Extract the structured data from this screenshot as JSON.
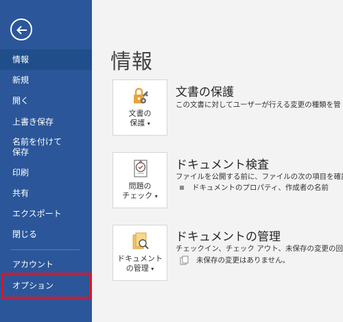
{
  "sidebar": {
    "back_label": "戻る",
    "items": [
      {
        "label": "情報",
        "active": true
      },
      {
        "label": "新規"
      },
      {
        "label": "開く"
      },
      {
        "label": "上書き保存"
      },
      {
        "label": "名前を付けて\n保存"
      },
      {
        "label": "印刷"
      },
      {
        "label": "共有"
      },
      {
        "label": "エクスポート"
      },
      {
        "label": "閉じる"
      },
      {
        "label": "アカウント"
      },
      {
        "label": "オプション",
        "highlighted": true
      }
    ]
  },
  "main": {
    "title": "情報",
    "sections": [
      {
        "tile_line1": "文書の",
        "tile_line2": "保護",
        "title": "文書の保護",
        "description": "この文書に対してユーザーが行える変更の種類を管"
      },
      {
        "tile_line1": "問題の",
        "tile_line2": "チェック",
        "title": "ドキュメント検査",
        "description": "ファイルを公開する前に、ファイルの次の項目を確認し",
        "bullet": "ドキュメントのプロパティ、作成者の名前"
      },
      {
        "tile_line1": "ドキュメント",
        "tile_line2": "の管理",
        "title": "ドキュメントの管理",
        "description": "チェックイン、チェック アウト、未保存の変更の回復を行",
        "bullet": "未保存の変更はありません。"
      }
    ]
  },
  "colors": {
    "sidebar": "#2b579a",
    "sidebar_active": "#1f4e8b",
    "highlight_border": "#e81123",
    "content_bg": "#f3f3f3"
  }
}
